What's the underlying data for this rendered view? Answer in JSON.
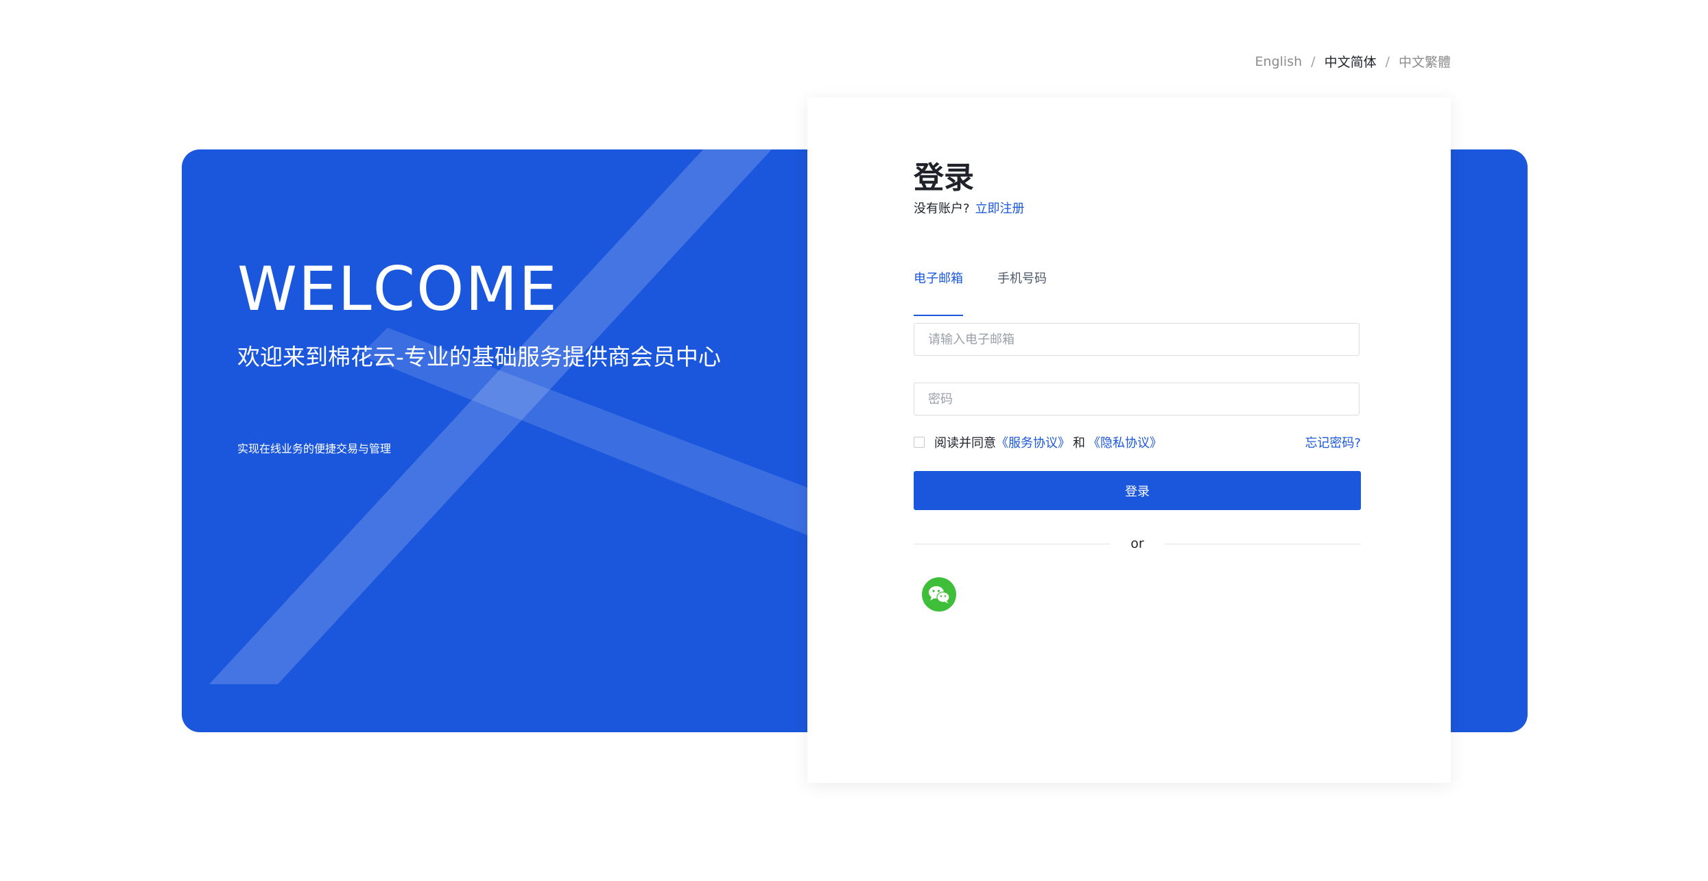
{
  "language": {
    "options": [
      "English",
      "中文简体",
      "中文繁體"
    ],
    "separator": "/",
    "selected": "中文简体"
  },
  "hero": {
    "title": "WELCOME",
    "subtitle": "欢迎来到棉花云-专业的基础服务提供商会员中心",
    "tagline": "实现在线业务的便捷交易与管理"
  },
  "login": {
    "title": "登录",
    "no_account_text": "没有账户?",
    "register_link": "立即注册",
    "tabs": [
      {
        "label": "电子邮箱",
        "active": true
      },
      {
        "label": "手机号码",
        "active": false
      }
    ],
    "email_placeholder": "请输入电子邮箱",
    "password_placeholder": "密码",
    "agree_prefix": "阅读并同意",
    "service_agreement": "《服务协议》",
    "and_text": "和",
    "privacy_agreement": "《隐私协议》",
    "forgot_password": "忘记密码?",
    "submit_label": "登录",
    "or_text": "or",
    "social": [
      {
        "icon": "wechat-icon",
        "color": "#3fbe3a"
      }
    ]
  },
  "colors": {
    "primary": "#1b57dc",
    "wechat": "#3fbe3a"
  }
}
